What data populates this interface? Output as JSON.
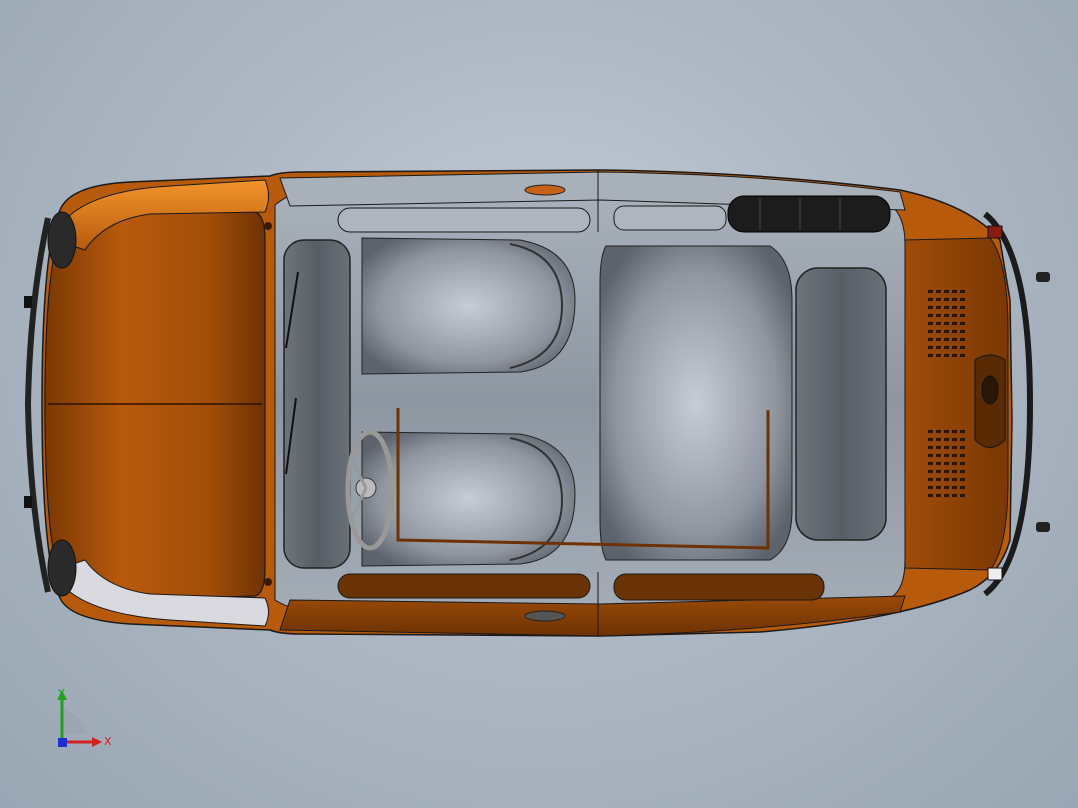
{
  "viewport": {
    "background": "#aeb8c4"
  },
  "model": {
    "body_color": "#b85a0c",
    "body_dark": "#6e3204",
    "body_highlight": "#e48828",
    "glass_color": "#9ca5b1",
    "interior_color": "#8a929c",
    "edge_color": "#1a1a1a",
    "tire_color": "#1c1c1c"
  },
  "triad": {
    "x_label": "X",
    "y_label": "Y",
    "x_color": "#d42020",
    "y_color": "#1fa21f",
    "z_color": "#1d2fd0"
  }
}
